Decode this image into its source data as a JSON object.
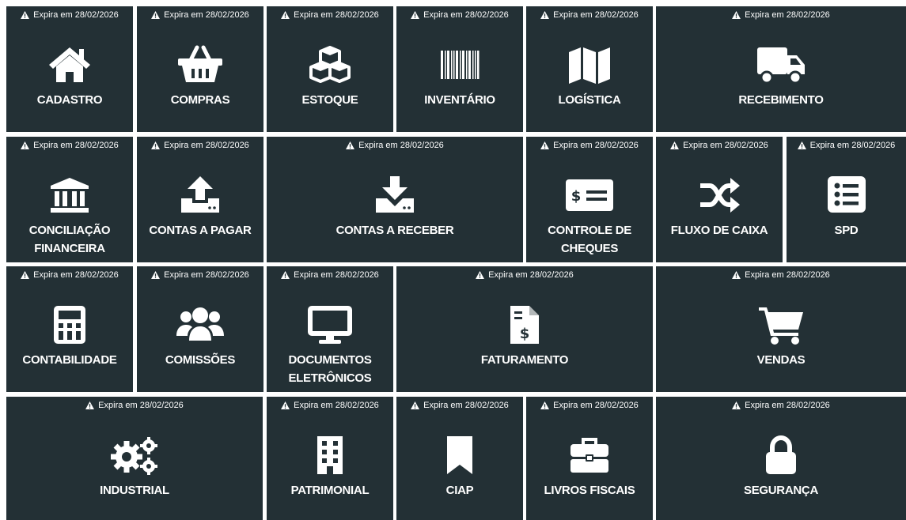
{
  "warning_text": "Expira em 28/02/2026",
  "tiles": [
    {
      "label": "CADASTRO",
      "icon": "home-icon"
    },
    {
      "label": "COMPRAS",
      "icon": "basket-icon"
    },
    {
      "label": "ESTOQUE",
      "icon": "cubes-icon"
    },
    {
      "label": "INVENTÁRIO",
      "icon": "barcode-icon"
    },
    {
      "label": "LOGÍSTICA",
      "icon": "map-icon"
    },
    {
      "label": "RECEBIMENTO",
      "icon": "truck-icon"
    },
    {
      "label": "CONCILIAÇÃO FINANCEIRA",
      "icon": "bank-icon"
    },
    {
      "label": "CONTAS A PAGAR",
      "icon": "upload-icon"
    },
    {
      "label": "CONTAS A RECEBER",
      "icon": "download-icon"
    },
    {
      "label": "CONTROLE DE CHEQUES",
      "icon": "check-money-icon"
    },
    {
      "label": "FLUXO DE CAIXA",
      "icon": "shuffle-icon"
    },
    {
      "label": "SPD",
      "icon": "list-icon"
    },
    {
      "label": "CONTABILIDADE",
      "icon": "calculator-icon"
    },
    {
      "label": "COMISSÕES",
      "icon": "users-icon"
    },
    {
      "label": "DOCUMENTOS ELETRÔNICOS",
      "icon": "desktop-icon"
    },
    {
      "label": "FATURAMENTO",
      "icon": "invoice-dollar-icon"
    },
    {
      "label": "VENDAS",
      "icon": "cart-icon"
    },
    {
      "label": "INDUSTRIAL",
      "icon": "cogs-icon"
    },
    {
      "label": "PATRIMONIAL",
      "icon": "building-icon"
    },
    {
      "label": "CIAP",
      "icon": "bookmark-icon"
    },
    {
      "label": "LIVROS FISCAIS",
      "icon": "toolbox-icon"
    },
    {
      "label": "SEGURANÇA",
      "icon": "lock-icon"
    }
  ],
  "colors": {
    "tile_background": "#233035",
    "text": "#ffffff",
    "page_background": "#ffffff"
  }
}
